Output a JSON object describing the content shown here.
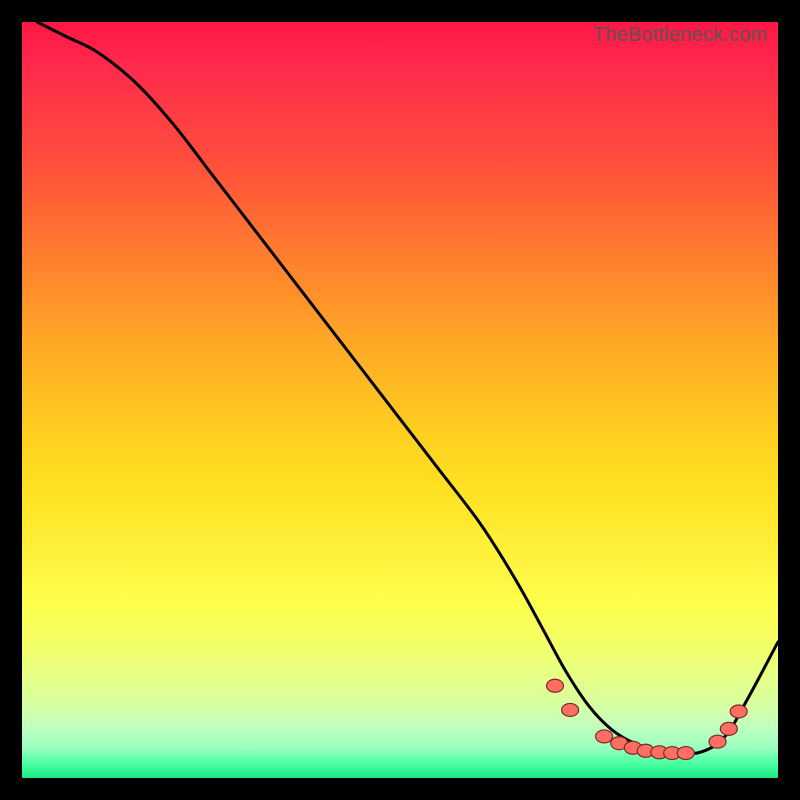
{
  "watermark": "TheBottleneck.com",
  "chart_data": {
    "type": "line",
    "title": "",
    "xlabel": "",
    "ylabel": "",
    "xlim": [
      0,
      100
    ],
    "ylim": [
      0,
      100
    ],
    "legend": false,
    "grid": false,
    "background_gradient": {
      "direction": "vertical",
      "top_color": "#ff1744",
      "bottom_color": "#18e884",
      "stops": [
        "red",
        "orange",
        "yellow",
        "green"
      ]
    },
    "series": [
      {
        "name": "curve",
        "color": "#000000",
        "x": [
          2,
          6,
          10,
          15,
          20,
          25,
          30,
          35,
          40,
          45,
          50,
          55,
          60,
          63,
          66,
          69,
          72,
          75,
          78,
          81,
          84,
          87,
          90,
          93,
          96,
          100
        ],
        "y": [
          100,
          98,
          96,
          92,
          86.5,
          80,
          73.5,
          67,
          60.5,
          54,
          47.5,
          41,
          34.5,
          30,
          25,
          19.5,
          14,
          9.5,
          6.4,
          4.6,
          3.7,
          3.3,
          3.5,
          5.5,
          10.5,
          18
        ]
      }
    ],
    "markers": {
      "name": "highlight-dots",
      "color": "#ff6e63",
      "points": [
        {
          "x": 70.5,
          "y": 12.2
        },
        {
          "x": 72.5,
          "y": 9.0
        },
        {
          "x": 77.0,
          "y": 5.5
        },
        {
          "x": 79.0,
          "y": 4.6
        },
        {
          "x": 80.8,
          "y": 4.0
        },
        {
          "x": 82.5,
          "y": 3.6
        },
        {
          "x": 84.3,
          "y": 3.4
        },
        {
          "x": 86.0,
          "y": 3.3
        },
        {
          "x": 87.8,
          "y": 3.3
        },
        {
          "x": 92.0,
          "y": 4.8
        },
        {
          "x": 93.5,
          "y": 6.5
        },
        {
          "x": 94.8,
          "y": 8.8
        }
      ]
    }
  }
}
